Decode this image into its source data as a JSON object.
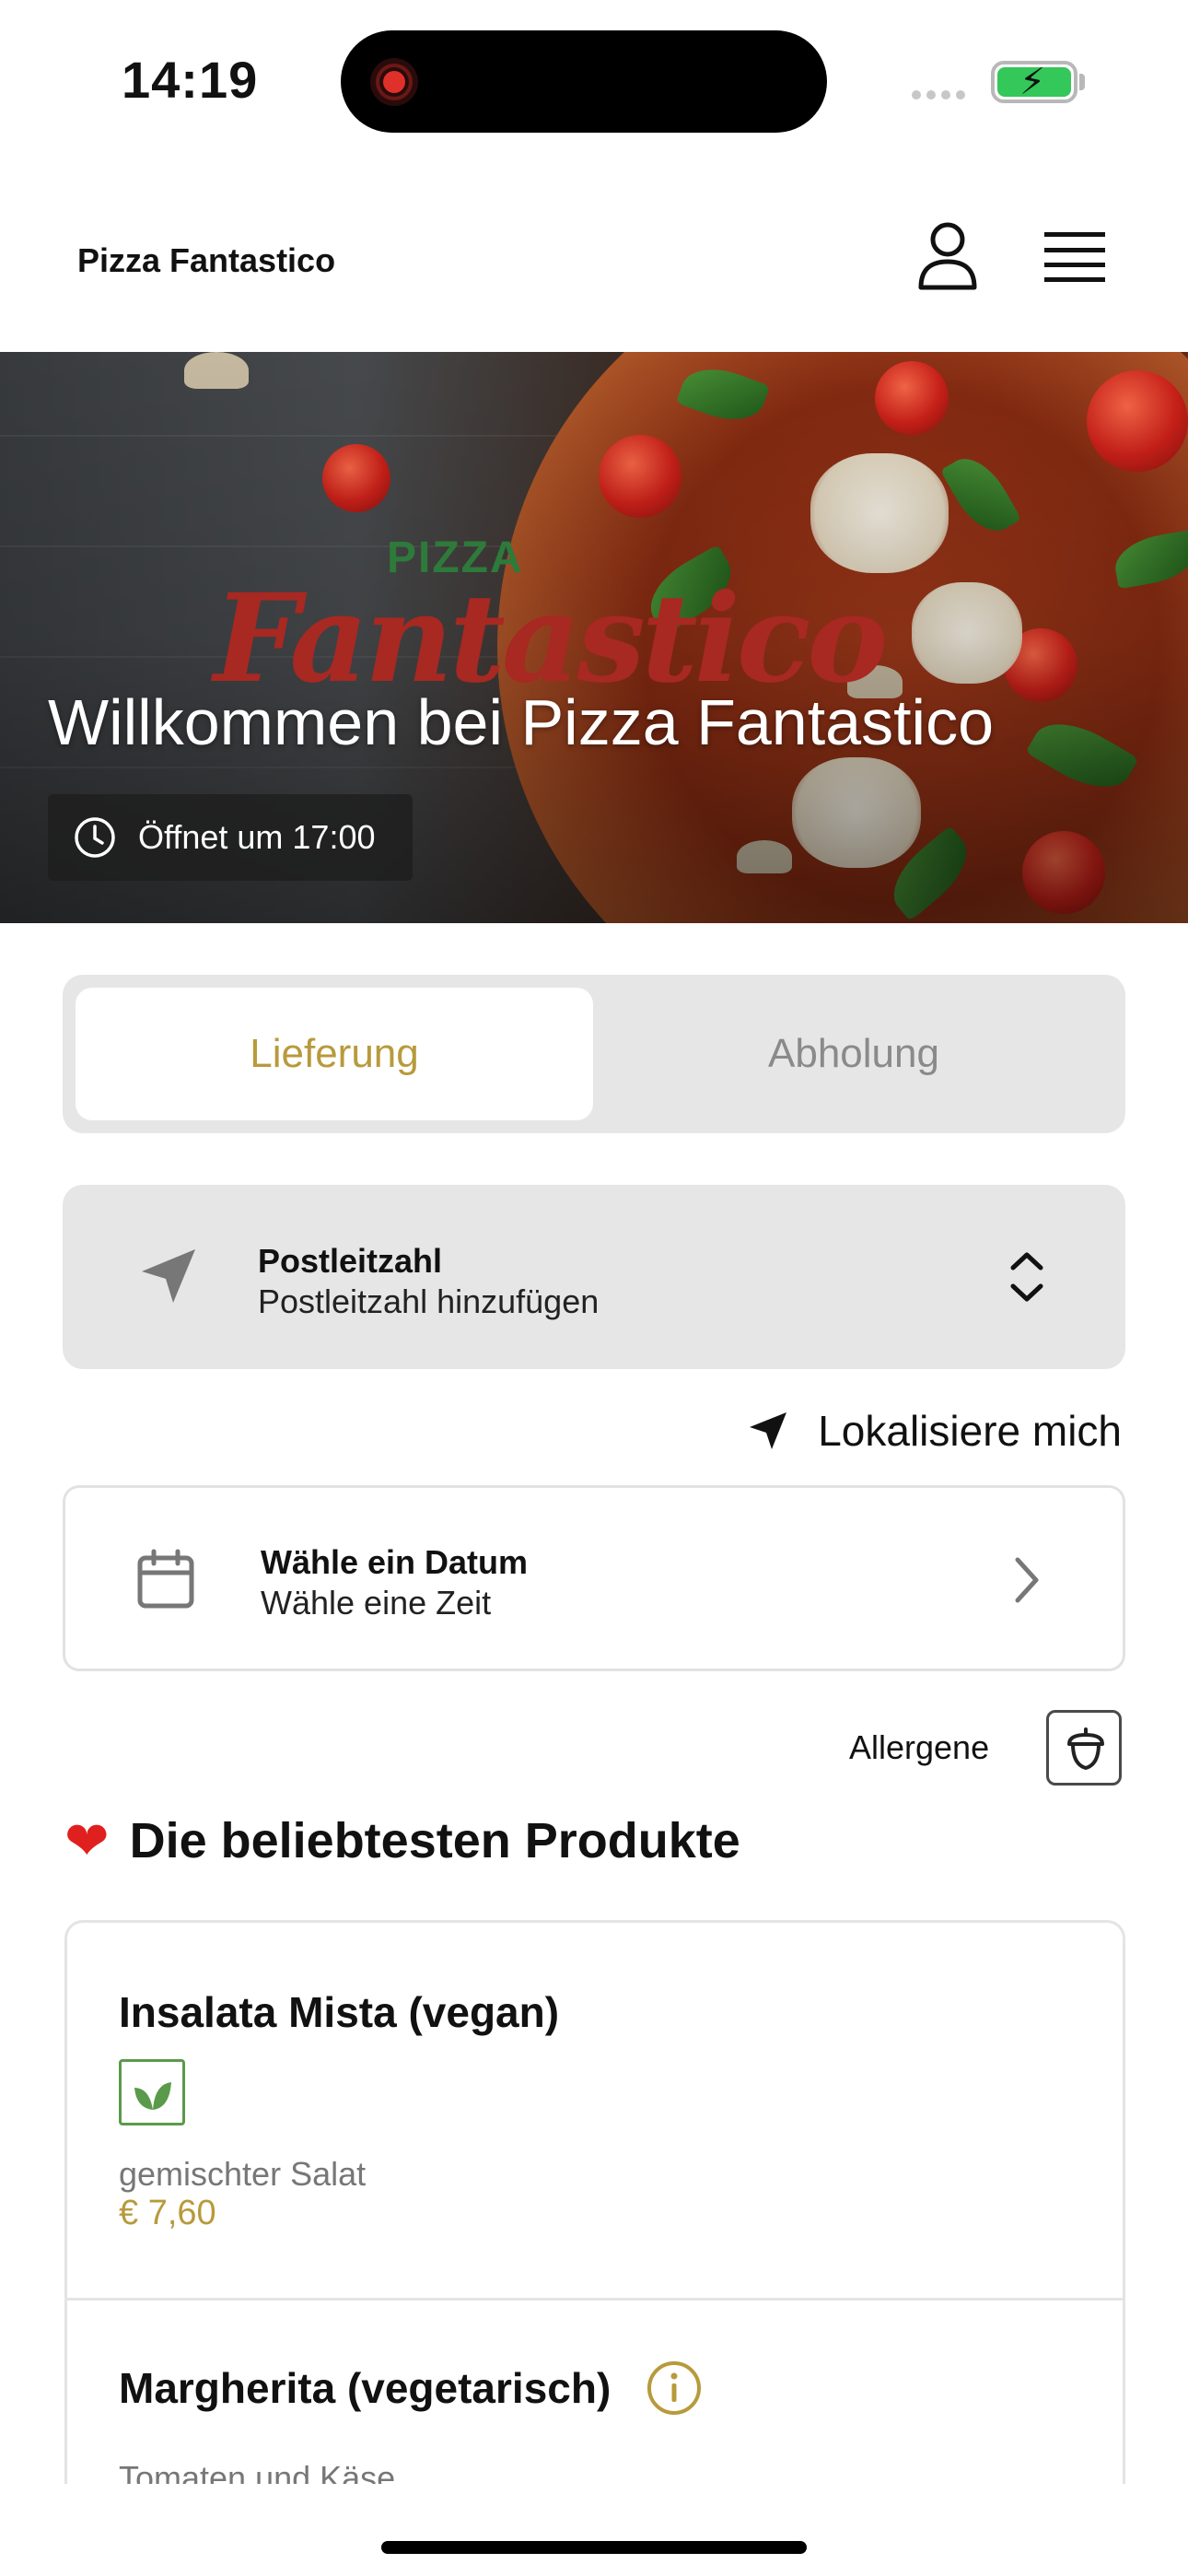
{
  "status_bar": {
    "time": "14:19"
  },
  "header": {
    "brand": "Pizza Fantastico"
  },
  "hero": {
    "logo_top": "PIZZA",
    "logo_script": "Fantastico",
    "title": "Willkommen bei Pizza Fantastico",
    "opening_hours": "Öffnet um 17:00"
  },
  "order_mode": {
    "tabs": [
      "Lieferung",
      "Abholung"
    ],
    "selected": "Lieferung"
  },
  "postal": {
    "label": "Postleitzahl",
    "placeholder": "Postleitzahl hinzufügen"
  },
  "locate": {
    "label": "Lokalisiere mich"
  },
  "date_picker": {
    "label": "Wähle ein Datum",
    "sub": "Wähle eine Zeit"
  },
  "allergens": {
    "label": "Allergene"
  },
  "popular": {
    "title": "Die beliebtesten Produkte",
    "products": [
      {
        "name": "Insalata Mista (vegan)",
        "badge": "leaf-icon",
        "description": "gemischter Salat",
        "price": "€ 7,60"
      },
      {
        "name": "Margherita (vegetarisch)",
        "badge": "info-icon",
        "description": "Tomaten und Käse"
      }
    ]
  },
  "colors": {
    "accent": "#b89a3c",
    "segment_bg": "#e6e6e6",
    "vegan_green": "#5a9a4a"
  }
}
